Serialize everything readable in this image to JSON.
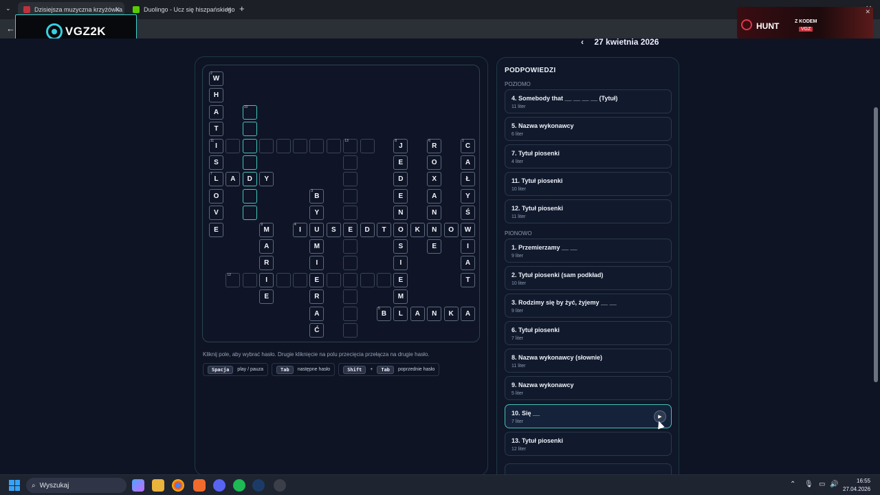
{
  "browser": {
    "tabs": [
      {
        "title": "Dzisiejsza muzyczna krzyżówka",
        "active": true,
        "color": "#c0303c"
      },
      {
        "title": "Duolingo - Ucz się hiszpańskiego",
        "active": false,
        "color": "#58cc02"
      }
    ],
    "new_tab": "+",
    "minimize": "—",
    "close": "✕"
  },
  "logo": {
    "text": "VGZ2K"
  },
  "ad": {
    "brand": "HUNT",
    "promo": "Z KODEM",
    "code": "VGZ"
  },
  "date_nav": {
    "prev": "‹",
    "date": "27 kwietnia 2026"
  },
  "grid": {
    "cells": [
      {
        "r": 0,
        "c": 0,
        "l": "W",
        "n": "2"
      },
      {
        "r": 1,
        "c": 0,
        "l": "H"
      },
      {
        "r": 2,
        "c": 0,
        "l": "A"
      },
      {
        "r": 2,
        "c": 2,
        "l": "",
        "n": "10",
        "hl": true
      },
      {
        "r": 3,
        "c": 0,
        "l": "T"
      },
      {
        "r": 3,
        "c": 2,
        "l": "",
        "hl": true
      },
      {
        "r": 4,
        "c": 0,
        "l": "I",
        "n": "11"
      },
      {
        "r": 4,
        "c": 1,
        "l": ""
      },
      {
        "r": 4,
        "c": 2,
        "l": "",
        "hl": true
      },
      {
        "r": 4,
        "c": 3,
        "l": ""
      },
      {
        "r": 4,
        "c": 4,
        "l": ""
      },
      {
        "r": 4,
        "c": 5,
        "l": ""
      },
      {
        "r": 4,
        "c": 6,
        "l": ""
      },
      {
        "r": 4,
        "c": 7,
        "l": ""
      },
      {
        "r": 4,
        "c": 8,
        "l": "",
        "n": "13"
      },
      {
        "r": 4,
        "c": 9,
        "l": ""
      },
      {
        "r": 4,
        "c": 11,
        "l": "J",
        "n": "8"
      },
      {
        "r": 4,
        "c": 13,
        "l": "R",
        "n": "6"
      },
      {
        "r": 4,
        "c": 15,
        "l": "C",
        "n": "1"
      },
      {
        "r": 5,
        "c": 0,
        "l": "S"
      },
      {
        "r": 5,
        "c": 2,
        "l": "",
        "hl": true
      },
      {
        "r": 5,
        "c": 8,
        "l": ""
      },
      {
        "r": 5,
        "c": 11,
        "l": "E"
      },
      {
        "r": 5,
        "c": 13,
        "l": "O"
      },
      {
        "r": 5,
        "c": 15,
        "l": "A"
      },
      {
        "r": 6,
        "c": 0,
        "l": "L",
        "n": "7"
      },
      {
        "r": 6,
        "c": 1,
        "l": "A"
      },
      {
        "r": 6,
        "c": 2,
        "l": "D",
        "hl": true
      },
      {
        "r": 6,
        "c": 3,
        "l": "Y"
      },
      {
        "r": 6,
        "c": 8,
        "l": ""
      },
      {
        "r": 6,
        "c": 11,
        "l": "D"
      },
      {
        "r": 6,
        "c": 13,
        "l": "X"
      },
      {
        "r": 6,
        "c": 15,
        "l": "Ł"
      },
      {
        "r": 7,
        "c": 0,
        "l": "O"
      },
      {
        "r": 7,
        "c": 2,
        "l": "",
        "hl": true
      },
      {
        "r": 7,
        "c": 6,
        "l": "B",
        "n": "3"
      },
      {
        "r": 7,
        "c": 8,
        "l": ""
      },
      {
        "r": 7,
        "c": 11,
        "l": "E"
      },
      {
        "r": 7,
        "c": 13,
        "l": "A"
      },
      {
        "r": 7,
        "c": 15,
        "l": "Y"
      },
      {
        "r": 8,
        "c": 0,
        "l": "V"
      },
      {
        "r": 8,
        "c": 2,
        "l": "",
        "hl": true
      },
      {
        "r": 8,
        "c": 6,
        "l": "Y"
      },
      {
        "r": 8,
        "c": 8,
        "l": ""
      },
      {
        "r": 8,
        "c": 11,
        "l": "N"
      },
      {
        "r": 8,
        "c": 13,
        "l": "N"
      },
      {
        "r": 8,
        "c": 15,
        "l": "Ś"
      },
      {
        "r": 9,
        "c": 0,
        "l": "E"
      },
      {
        "r": 9,
        "c": 3,
        "l": "M",
        "n": "9"
      },
      {
        "r": 9,
        "c": 5,
        "l": "I",
        "n": "4"
      },
      {
        "r": 9,
        "c": 6,
        "l": "U"
      },
      {
        "r": 9,
        "c": 7,
        "l": "S"
      },
      {
        "r": 9,
        "c": 8,
        "l": "E"
      },
      {
        "r": 9,
        "c": 9,
        "l": "D"
      },
      {
        "r": 9,
        "c": 10,
        "l": "T"
      },
      {
        "r": 9,
        "c": 11,
        "l": "O"
      },
      {
        "r": 9,
        "c": 12,
        "l": "K"
      },
      {
        "r": 9,
        "c": 13,
        "l": "N"
      },
      {
        "r": 9,
        "c": 14,
        "l": "O"
      },
      {
        "r": 9,
        "c": 15,
        "l": "W"
      },
      {
        "r": 10,
        "c": 3,
        "l": "A"
      },
      {
        "r": 10,
        "c": 6,
        "l": "M"
      },
      {
        "r": 10,
        "c": 8,
        "l": ""
      },
      {
        "r": 10,
        "c": 11,
        "l": "S"
      },
      {
        "r": 10,
        "c": 13,
        "l": "E"
      },
      {
        "r": 10,
        "c": 15,
        "l": "I"
      },
      {
        "r": 11,
        "c": 3,
        "l": "R"
      },
      {
        "r": 11,
        "c": 6,
        "l": "I"
      },
      {
        "r": 11,
        "c": 8,
        "l": ""
      },
      {
        "r": 11,
        "c": 11,
        "l": "I"
      },
      {
        "r": 11,
        "c": 15,
        "l": "A"
      },
      {
        "r": 12,
        "c": 1,
        "l": "",
        "n": "12"
      },
      {
        "r": 12,
        "c": 2,
        "l": ""
      },
      {
        "r": 12,
        "c": 3,
        "l": "I"
      },
      {
        "r": 12,
        "c": 4,
        "l": ""
      },
      {
        "r": 12,
        "c": 5,
        "l": ""
      },
      {
        "r": 12,
        "c": 6,
        "l": "E"
      },
      {
        "r": 12,
        "c": 7,
        "l": ""
      },
      {
        "r": 12,
        "c": 8,
        "l": ""
      },
      {
        "r": 12,
        "c": 9,
        "l": ""
      },
      {
        "r": 12,
        "c": 10,
        "l": ""
      },
      {
        "r": 12,
        "c": 11,
        "l": "E"
      },
      {
        "r": 12,
        "c": 15,
        "l": "T"
      },
      {
        "r": 13,
        "c": 3,
        "l": "E"
      },
      {
        "r": 13,
        "c": 6,
        "l": "R"
      },
      {
        "r": 13,
        "c": 8,
        "l": ""
      },
      {
        "r": 13,
        "c": 11,
        "l": "M"
      },
      {
        "r": 14,
        "c": 6,
        "l": "A"
      },
      {
        "r": 14,
        "c": 8,
        "l": ""
      },
      {
        "r": 14,
        "c": 10,
        "l": "B",
        "n": "5"
      },
      {
        "r": 14,
        "c": 11,
        "l": "L"
      },
      {
        "r": 14,
        "c": 12,
        "l": "A"
      },
      {
        "r": 14,
        "c": 13,
        "l": "N"
      },
      {
        "r": 14,
        "c": 14,
        "l": "K"
      },
      {
        "r": 14,
        "c": 15,
        "l": "A"
      },
      {
        "r": 15,
        "c": 6,
        "l": "Ć"
      },
      {
        "r": 15,
        "c": 8,
        "l": ""
      }
    ]
  },
  "instructions": {
    "hint": "Kliknij pole, aby wybrać hasło. Drugie kliknięcie na polu przecięcia przełącza na drugie hasło.",
    "space_key": "Spacja",
    "space_label": "play / pauza",
    "tab_key": "Tab",
    "tab_label": "następne hasło",
    "shift_key": "Shift",
    "plus": "+",
    "tab_key2": "Tab",
    "shift_tab_label": "poprzednie hasło"
  },
  "clues": {
    "title": "PODPOWIEDZI",
    "across_label": "POZIOMO",
    "across": [
      {
        "t": "4. Somebody that __ __ __ __ (Tytuł)",
        "s": "11 liter"
      },
      {
        "t": "5. Nazwa wykonawcy",
        "s": "6 liter"
      },
      {
        "t": "7. Tytuł piosenki",
        "s": "4 liter"
      },
      {
        "t": "11. Tytuł piosenki",
        "s": "10 liter"
      },
      {
        "t": "12. Tytuł piosenki",
        "s": "11 liter"
      }
    ],
    "down_label": "PIONOWO",
    "down": [
      {
        "t": "1. Przemierzamy __ __",
        "s": "9 liter"
      },
      {
        "t": "2. Tytuł piosenki (sam podkład)",
        "s": "10 liter"
      },
      {
        "t": "3. Rodzimy się by żyć, żyjemy __ __",
        "s": "9 liter"
      },
      {
        "t": "6. Tytuł piosenki",
        "s": "7 liter"
      },
      {
        "t": "8. Nazwa wykonawcy (słownie)",
        "s": "11 liter"
      },
      {
        "t": "9. Nazwa wykonawcy",
        "s": "5 liter"
      },
      {
        "t": "10. Się __",
        "s": "7 liter",
        "active": true
      },
      {
        "t": "13. Tytuł piosenki",
        "s": "12 liter"
      }
    ]
  },
  "taskbar": {
    "search": "Wyszukaj",
    "time": "16:55",
    "date": "27.04.2026"
  }
}
